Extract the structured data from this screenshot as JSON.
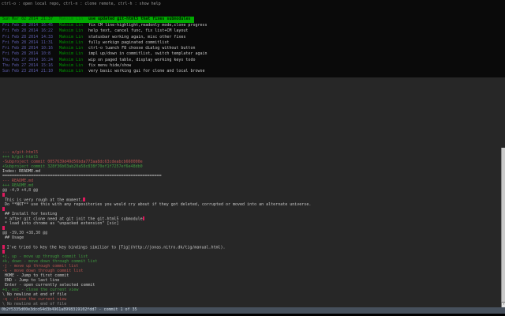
{
  "menu_bar": {
    "text": "ctrl-o : open local repo, ctrl-n : clone remote, ctrl-h : show help"
  },
  "commit_list": {
    "selected_index": 0,
    "commits": [
      {
        "date": "Sun Mar 02 2014",
        "time": "21:37",
        "author": "Maksim Lin",
        "message": "use updated git-html5 that fixes submodules"
      },
      {
        "date": "Fri Feb 28 2014",
        "time": "16:45",
        "author": "Maksim Lin",
        "message": "fix CM line-highlight,readonly mode,clone progress"
      },
      {
        "date": "Fri Feb 28 2014",
        "time": "16:22",
        "author": "Maksim Lin",
        "message": "help text, cancel func, fix list+CM layout"
      },
      {
        "date": "Fri Feb 28 2014",
        "time": "14:33",
        "author": "Maksim Lin",
        "message": "statusbar working again, misc other fixes"
      },
      {
        "date": "Fri Feb 28 2014",
        "time": "11:31",
        "author": "Maksim Lin",
        "message": "fully workign paginated commitlist"
      },
      {
        "date": "Fri Feb 28 2014",
        "time": "10:16",
        "author": "Maksim Lin",
        "message": "ctrl-o luanch F8 choose dialog without button"
      },
      {
        "date": "Fri Feb 28 2014",
        "time": "10:8",
        "author": "Maksim Lin",
        "message": "impl up/down in commitlist, switch templater again"
      },
      {
        "date": "Thu Feb 27 2014",
        "time": "16:24",
        "author": "Maksim Lin",
        "message": "wip on paged table, display working keys todo"
      },
      {
        "date": "Thu Feb 27 2014",
        "time": "15:16",
        "author": "Maksim Lin",
        "message": "fix menu hide/show"
      },
      {
        "date": "Sun Feb 23 2014",
        "time": "21:10",
        "author": "Maksim Lin",
        "message": "very basic working gui for clone and local browse"
      }
    ]
  },
  "diff_view": {
    "lines": [
      {
        "text": "--- a/git-html5",
        "type": "del"
      },
      {
        "text": "+++ b/git-html5",
        "type": "add"
      },
      {
        "text": "-Subproject commit 0057639d49d56bda773aa8dc63cdeabcb660000e",
        "type": "del"
      },
      {
        "text": "+Subproject commit 328f36b03ab20a58c838f70ef1f7257ef6e48db0",
        "type": "add"
      },
      {
        "text": "Index: README.md",
        "type": "meta"
      },
      {
        "text": "===================================================================",
        "type": "meta"
      },
      {
        "text": "--- README.md",
        "type": "del"
      },
      {
        "text": "+++ README.md",
        "type": "add"
      },
      {
        "text": "@@ -4,9 +4,8 @@",
        "type": "hunk"
      },
      {
        "text": "",
        "type": "ctx",
        "lead_ws": true
      },
      {
        "text": " This is very rough at the moment.",
        "type": "ctx",
        "trail_ws": true
      },
      {
        "text": " Do **NOT** use this with any repositories you would cry about if they got deleted, corrupted or moved into an alternate universe.",
        "type": "ctx"
      },
      {
        "text": "",
        "type": "ctx",
        "lead_ws": true
      },
      {
        "text": " ## Install for testing",
        "type": "ctx"
      },
      {
        "text": " * after git clone need at git init the git-html5 submodule",
        "type": "ctx",
        "trail_ws": true
      },
      {
        "text": " * load into chrome as \"unpacked extension\" [sic]",
        "type": "ctx"
      },
      {
        "text": "",
        "type": "ctx",
        "lead_ws": true
      },
      {
        "text": "@@ -39,30 +38,30 @@",
        "type": "hunk"
      },
      {
        "text": " ## Usage",
        "type": "ctx"
      },
      {
        "text": "",
        "type": "blank"
      },
      {
        "text": " I've tried to key the key bindings similiar to [Tig](http://jonas.nitro.dk/tig/manual.html).",
        "type": "ctx",
        "lead_ws": true
      },
      {
        "text": "",
        "type": "ctx",
        "lead_ws": true
      },
      {
        "text": "+j, up - move up through commit list",
        "type": "add"
      },
      {
        "text": "+k, down - move down through commit list",
        "type": "add"
      },
      {
        "text": "-j - move up through commit list",
        "type": "del"
      },
      {
        "text": "-k - move down through commit list",
        "type": "del"
      },
      {
        "text": " HOME - Jump to first commit",
        "type": "ctx"
      },
      {
        "text": " END - Jump to last line",
        "type": "ctx"
      },
      {
        "text": " Enter - open currently selected commit",
        "type": "ctx"
      },
      {
        "text": "+q, esc - close the current view",
        "type": "add"
      },
      {
        "text": "\\ No newline at end of file",
        "type": "ctx"
      },
      {
        "text": "-q - close the current view",
        "type": "del"
      },
      {
        "text": "\\ No newline at end of file",
        "type": "ctx",
        "dim": true
      }
    ]
  },
  "status_bar": {
    "text": "0b2f5335d00e3dcc64d3b4961a8998319102fdd7 - commit 1 of 35"
  },
  "scrollbar": {
    "down_arrow": "▾"
  },
  "colors": {
    "selection_green": "#00a800",
    "date_blue": "#5f5faf",
    "author_green": "#009900",
    "diff_del_red": "#b85450",
    "diff_add_green": "#3f9b3f",
    "whitespace_pink": "#e0195e",
    "statusbar_bg": "#46505c"
  }
}
